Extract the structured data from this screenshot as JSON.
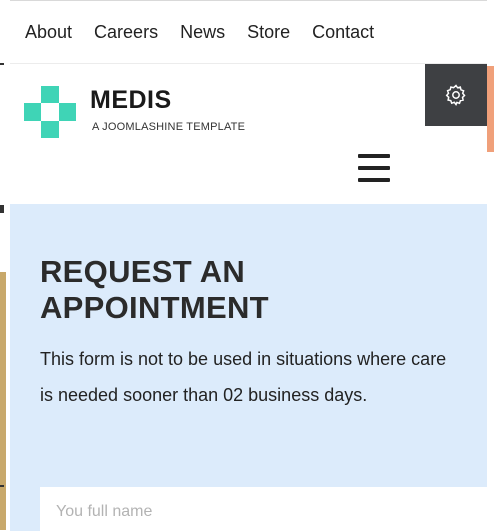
{
  "topnav": {
    "items": [
      "About",
      "Careers",
      "News",
      "Store",
      "Contact"
    ]
  },
  "brand": {
    "title": "MEDIS",
    "subtitle": "A JOOMLASHINE TEMPLATE",
    "logo_color": "#3fd4b6"
  },
  "header": {
    "settings_icon": "gear-icon",
    "menu_icon": "hamburger-menu-icon"
  },
  "appointment": {
    "title": "REQUEST AN APPOINTMENT",
    "description": "This form is not to be used in situations where care is needed sooner than 02 business days.",
    "name_placeholder": "You full name",
    "background": "#dcebfb"
  },
  "colors": {
    "settings_bg": "#3e4043",
    "accent_right": "#f0a07a"
  }
}
